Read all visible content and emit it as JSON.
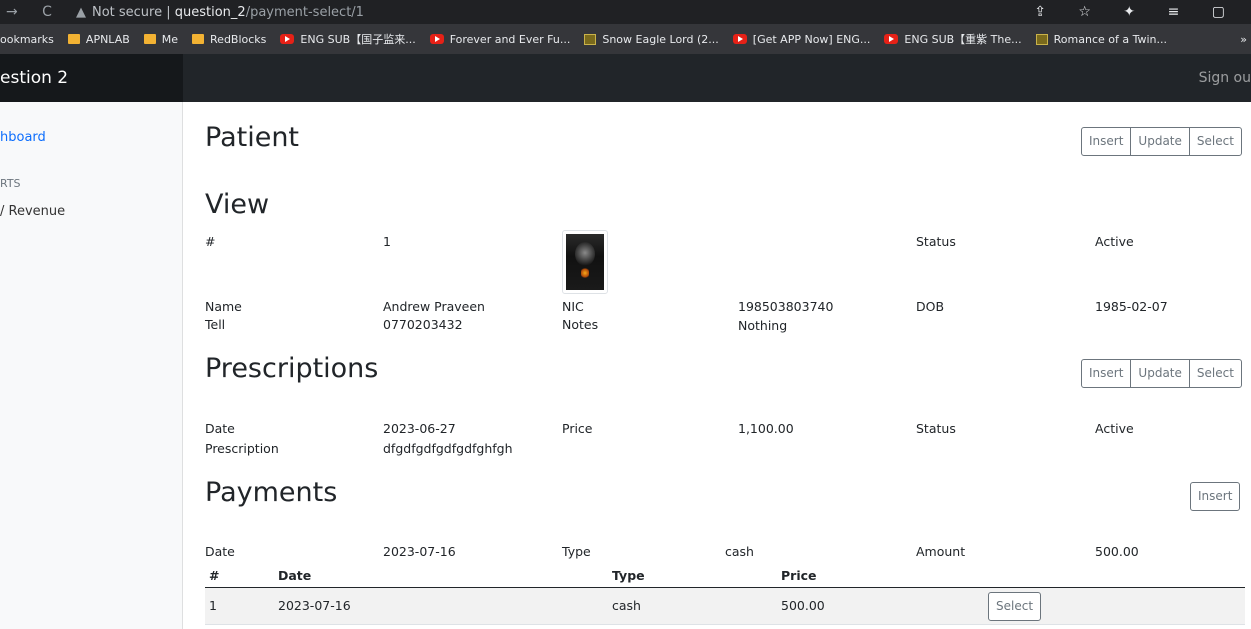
{
  "browser": {
    "security_text": "Not secure",
    "url_host": "question_2",
    "url_path": "/payment-select/1",
    "bookmarks": [
      {
        "label": "ookmarks",
        "icon": "none"
      },
      {
        "label": "APNLAB",
        "icon": "folder-icon"
      },
      {
        "label": "Me",
        "icon": "folder-icon"
      },
      {
        "label": "RedBlocks",
        "icon": "folder-icon"
      },
      {
        "label": "ENG SUB【国子监来...",
        "icon": "youtube-icon"
      },
      {
        "label": "Forever and Ever Fu...",
        "icon": "youtube-icon"
      },
      {
        "label": "Snow Eagle Lord (2...",
        "icon": "game-icon"
      },
      {
        "label": "[Get APP Now] ENG...",
        "icon": "youtube-icon"
      },
      {
        "label": "ENG SUB【重紫 The...",
        "icon": "youtube-icon"
      },
      {
        "label": "Romance of a Twin...",
        "icon": "game-icon"
      }
    ]
  },
  "navbar": {
    "brand": "estion 2",
    "signout": "Sign ou"
  },
  "sidebar": {
    "active": "hboard",
    "heading": "RTS",
    "revenue": "/ Revenue"
  },
  "patient": {
    "title": "Patient",
    "buttons": {
      "insert": "Insert",
      "update": "Update",
      "select": "Select"
    }
  },
  "view": {
    "title": "View",
    "id_label": "#",
    "id_value": "1",
    "status_label": "Status",
    "status_value": "Active",
    "name_label": "Name",
    "name_value": "Andrew Praveen",
    "nic_label": "NIC",
    "nic_value": "198503803740",
    "dob_label": "DOB",
    "dob_value": "1985-02-07",
    "tell_label": "Tell",
    "tell_value": "0770203432",
    "notes_label": "Notes",
    "notes_value": "Nothing"
  },
  "prescriptions": {
    "title": "Prescriptions",
    "buttons": {
      "insert": "Insert",
      "update": "Update",
      "select": "Select"
    },
    "date_label": "Date",
    "date_value": "2023-06-27",
    "price_label": "Price",
    "price_value": "1,100.00",
    "status_label": "Status",
    "status_value": "Active",
    "prescription_label": "Prescription",
    "prescription_value": "dfgdfgdfgdfgdfghfgh"
  },
  "payments": {
    "title": "Payments",
    "insert": "Insert",
    "date_label": "Date",
    "date_value": "2023-07-16",
    "type_label": "Type",
    "type_value": "cash",
    "amount_label": "Amount",
    "amount_value": "500.00",
    "table": {
      "headers": [
        "#",
        "Date",
        "Type",
        "Price"
      ],
      "rows": [
        {
          "num": "1",
          "date": "2023-07-16",
          "type": "cash",
          "price": "500.00",
          "action": "Select"
        }
      ]
    }
  }
}
